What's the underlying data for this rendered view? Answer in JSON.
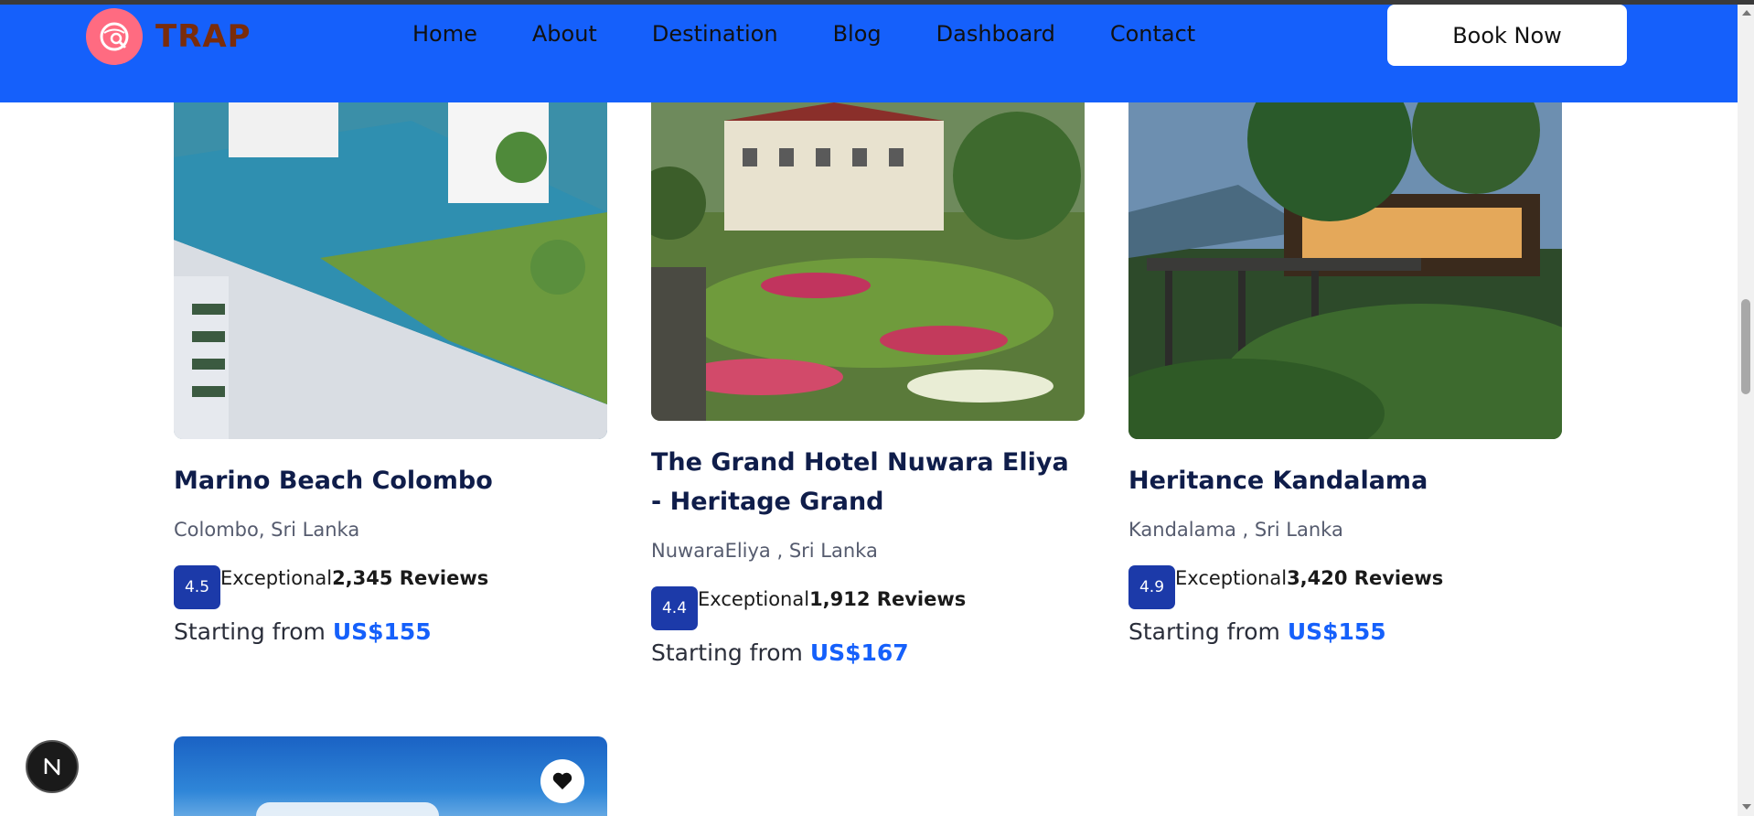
{
  "brand": {
    "name": "TRAP"
  },
  "nav": {
    "items": [
      {
        "label": "Home"
      },
      {
        "label": "About"
      },
      {
        "label": "Destination"
      },
      {
        "label": "Blog"
      },
      {
        "label": "Dashboard"
      },
      {
        "label": "Contact"
      }
    ],
    "cta_label": "Book Now"
  },
  "cards": [
    {
      "title": "Marino Beach Colombo",
      "location": "Colombo, Sri Lanka",
      "rating": "4.5",
      "rating_label": "Exceptional",
      "reviews": "2,345 Reviews",
      "price_prefix": "Starting from ",
      "price": "US$155"
    },
    {
      "title": "The Grand Hotel Nuwara Eliya - Heritage Grand",
      "location": "NuwaraEliya , Sri Lanka",
      "rating": "4.4",
      "rating_label": "Exceptional",
      "reviews": "1,912 Reviews",
      "price_prefix": "Starting from ",
      "price": "US$167"
    },
    {
      "title": "Heritance Kandalama",
      "location": "Kandalama , Sri Lanka",
      "rating": "4.9",
      "rating_label": "Exceptional",
      "reviews": "3,420 Reviews",
      "price_prefix": "Starting from ",
      "price": "US$155"
    }
  ],
  "colors": {
    "nav_bg": "#1560fb",
    "accent": "#1560fb",
    "rating_badge": "#1c3aa9",
    "logo_badge": "#ff6b81"
  },
  "icons": {
    "logo": "search-globe-icon",
    "favorite": "heart-icon",
    "dev_tool": "n-logo-icon"
  }
}
